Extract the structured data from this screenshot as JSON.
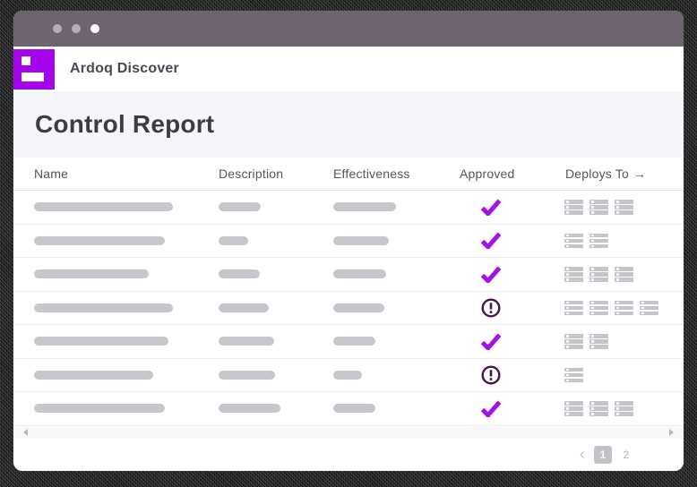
{
  "window": {
    "titlebar_dots": [
      "gray",
      "gray",
      "white"
    ]
  },
  "appbar": {
    "title": "Ardoq Discover"
  },
  "page": {
    "title": "Control Report"
  },
  "table": {
    "columns": [
      {
        "id": "name",
        "label": "Name"
      },
      {
        "id": "description",
        "label": "Description"
      },
      {
        "id": "effectiveness",
        "label": "Effectiveness"
      },
      {
        "id": "approved",
        "label": "Approved"
      },
      {
        "id": "deploys_to",
        "label": "Deploys To"
      }
    ],
    "deploys_arrow": "→",
    "rows": [
      {
        "name_bar_w": 155,
        "desc_bar_w": 47,
        "eff_bar_w": 70,
        "approved": "check",
        "deploy_targets": 3
      },
      {
        "name_bar_w": 146,
        "desc_bar_w": 33,
        "eff_bar_w": 62,
        "approved": "check",
        "deploy_targets": 2
      },
      {
        "name_bar_w": 128,
        "desc_bar_w": 46,
        "eff_bar_w": 59,
        "approved": "check",
        "deploy_targets": 3
      },
      {
        "name_bar_w": 155,
        "desc_bar_w": 56,
        "eff_bar_w": 57,
        "approved": "alert",
        "deploy_targets": 4
      },
      {
        "name_bar_w": 150,
        "desc_bar_w": 62,
        "eff_bar_w": 47,
        "approved": "check",
        "deploy_targets": 2
      },
      {
        "name_bar_w": 133,
        "desc_bar_w": 63,
        "eff_bar_w": 32,
        "approved": "alert",
        "deploy_targets": 1
      },
      {
        "name_bar_w": 146,
        "desc_bar_w": 69,
        "eff_bar_w": 47,
        "approved": "check",
        "deploy_targets": 3
      }
    ]
  },
  "pagination": {
    "prev": "‹",
    "pages": [
      "1",
      "2"
    ],
    "current_page": "1"
  },
  "colors": {
    "accent_purple": "#a405ec",
    "check_purple": "#a312e9",
    "alert_plum": "#451549",
    "topbar": "#6d6470",
    "placeholder_bar": "#c9c5cc",
    "hero_bg": "#f7f5f9"
  }
}
